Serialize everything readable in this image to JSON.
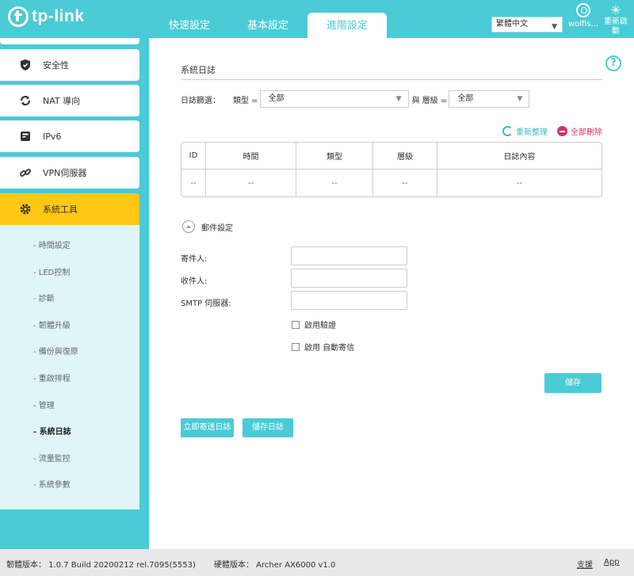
{
  "brand": {
    "logo_text": "tp-link"
  },
  "header": {
    "tabs": [
      "快速設定",
      "基本設定",
      "進階設定"
    ],
    "active_tab": "進階設定",
    "language": "繁體中文",
    "user": "wolfis...",
    "reboot": "重新啟動"
  },
  "sidebar": {
    "items": [
      {
        "label": "安全性",
        "icon": "shield-icon"
      },
      {
        "label": "NAT 導向",
        "icon": "nat-forwarding-icon"
      },
      {
        "label": "IPv6",
        "icon": "ipv6-icon"
      },
      {
        "label": "VPN伺服器",
        "icon": "vpn-link-icon"
      },
      {
        "label": "系統工具",
        "icon": "gear-icon",
        "active": true
      }
    ],
    "submenu": [
      "時間設定",
      "LED控制",
      "診斷",
      "韌體升級",
      "備份與復原",
      "重啟排程",
      "管理",
      "系統日誌",
      "流量監控",
      "系統參數"
    ],
    "current_submenu": "系統日誌"
  },
  "main": {
    "section_title": "系統日誌",
    "filter": {
      "label": "日誌篩選：",
      "type_label": "類型 =",
      "type_value": "全部",
      "and_level": "與 層級 =",
      "level_value": "全部"
    },
    "actions": {
      "refresh": "重新整理",
      "delete_all": "全部刪除"
    },
    "table": {
      "headers": [
        "ID",
        "時間",
        "類型",
        "層級",
        "日誌內容"
      ],
      "rows": [
        [
          "--",
          "--",
          "--",
          "--",
          "--"
        ]
      ]
    },
    "mail": {
      "title": "郵件設定",
      "from_label": "寄件人:",
      "to_label": "收件人:",
      "smtp_label": "SMTP 伺服器:",
      "enable_auth": "啟用驗證",
      "enable_auto": "啟用 自動寄信",
      "save": "儲存"
    },
    "buttons": {
      "send_now": "立即寄送日誌",
      "save_log": "儲存日誌"
    }
  },
  "footer": {
    "firmware": "韌體版本： 1.0.7 Build 20200212 rel.7095(5553)",
    "hardware": "硬體版本： Archer AX6000 v1.0",
    "support": "支援",
    "app": "App"
  },
  "colors": {
    "accent": "#4acbd6",
    "active_menu": "#ffc814",
    "delete": "#d4326a"
  }
}
